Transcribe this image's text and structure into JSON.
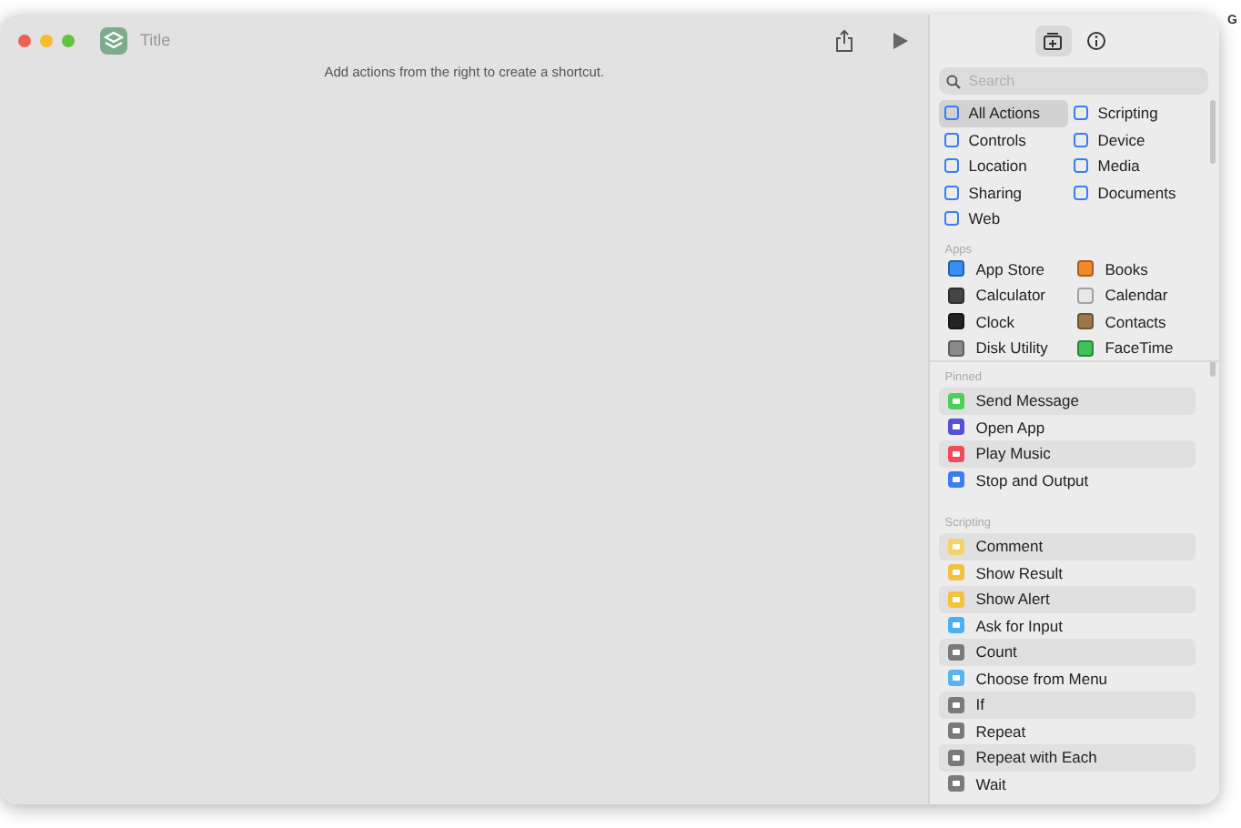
{
  "window": {
    "title": "Title",
    "hint": "Add actions from the right to create a shortcut."
  },
  "sidebar": {
    "tabs": [
      {
        "kind": "library",
        "selected": true
      },
      {
        "kind": "info",
        "selected": false
      }
    ],
    "search": {
      "placeholder": "Search"
    },
    "categories": [
      {
        "label": "All Actions",
        "selected": true
      },
      {
        "label": "Scripting",
        "selected": false
      },
      {
        "label": "Controls",
        "selected": false
      },
      {
        "label": "Device",
        "selected": false
      },
      {
        "label": "Location",
        "selected": false
      },
      {
        "label": "Media",
        "selected": false
      },
      {
        "label": "Sharing",
        "selected": false
      },
      {
        "label": "Documents",
        "selected": false
      },
      {
        "label": "Web",
        "selected": false
      }
    ],
    "apps_heading": "Apps",
    "apps": [
      {
        "label": "App Store",
        "color": "#3b8df0"
      },
      {
        "label": "Books",
        "color": "#f08a2c"
      },
      {
        "label": "Calculator",
        "color": "#444444"
      },
      {
        "label": "Calendar",
        "color": "#e8e8e8"
      },
      {
        "label": "Clock",
        "color": "#222222"
      },
      {
        "label": "Contacts",
        "color": "#9b7a4a"
      },
      {
        "label": "Disk Utility",
        "color": "#8a8a8a"
      },
      {
        "label": "FaceTime",
        "color": "#40c056"
      }
    ],
    "sections": [
      {
        "heading": "Pinned",
        "items": [
          {
            "label": "Send Message",
            "color": "#4cd05a"
          },
          {
            "label": "Open App",
            "color": "#5552d6"
          },
          {
            "label": "Play Music",
            "color": "#ef4d5c"
          },
          {
            "label": "Stop and Output",
            "color": "#3a7ff0"
          }
        ]
      },
      {
        "heading": "Scripting",
        "items": [
          {
            "label": "Comment",
            "color": "#f5d36b"
          },
          {
            "label": "Show Result",
            "color": "#f5c23e"
          },
          {
            "label": "Show Alert",
            "color": "#f5c23e"
          },
          {
            "label": "Ask for Input",
            "color": "#4eb0f0"
          },
          {
            "label": "Count",
            "color": "#7a7a7a"
          },
          {
            "label": "Choose from Menu",
            "color": "#5ab4f0"
          },
          {
            "label": "If",
            "color": "#7a7a7a"
          },
          {
            "label": "Repeat",
            "color": "#7a7a7a"
          },
          {
            "label": "Repeat with Each",
            "color": "#7a7a7a"
          },
          {
            "label": "Wait",
            "color": "#7a7a7a"
          }
        ]
      }
    ]
  },
  "corner_text": "G"
}
